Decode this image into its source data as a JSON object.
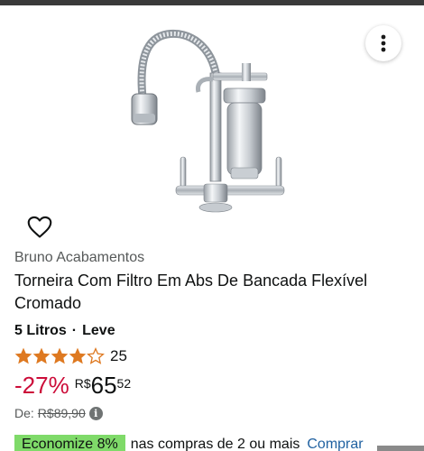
{
  "product": {
    "brand": "Bruno Acabamentos",
    "title": "Torneira Com Filtro Em Abs De Bancada Flexível Cromado",
    "variant_size": "5 Litros",
    "variant_separator": "·",
    "variant_type": "Leve",
    "rating_value": 4.5,
    "rating_count": "25",
    "discount": "-27%",
    "currency": "R$",
    "price_whole": "65",
    "price_cents": "52",
    "list_price_label": "De:",
    "list_price": "R$89,90",
    "info_glyph": "i"
  },
  "promo": {
    "badge": "Economize 8%",
    "text": "nas compras de 2 ou mais",
    "link": "Comprar"
  },
  "colors": {
    "discount": "#cc0c39",
    "star": "#de7921",
    "promo_badge": "#7fda69",
    "link": "#2162a1"
  },
  "icons": {
    "more": "more-vertical-icon",
    "wishlist": "heart-outline-icon",
    "info": "info-icon"
  }
}
